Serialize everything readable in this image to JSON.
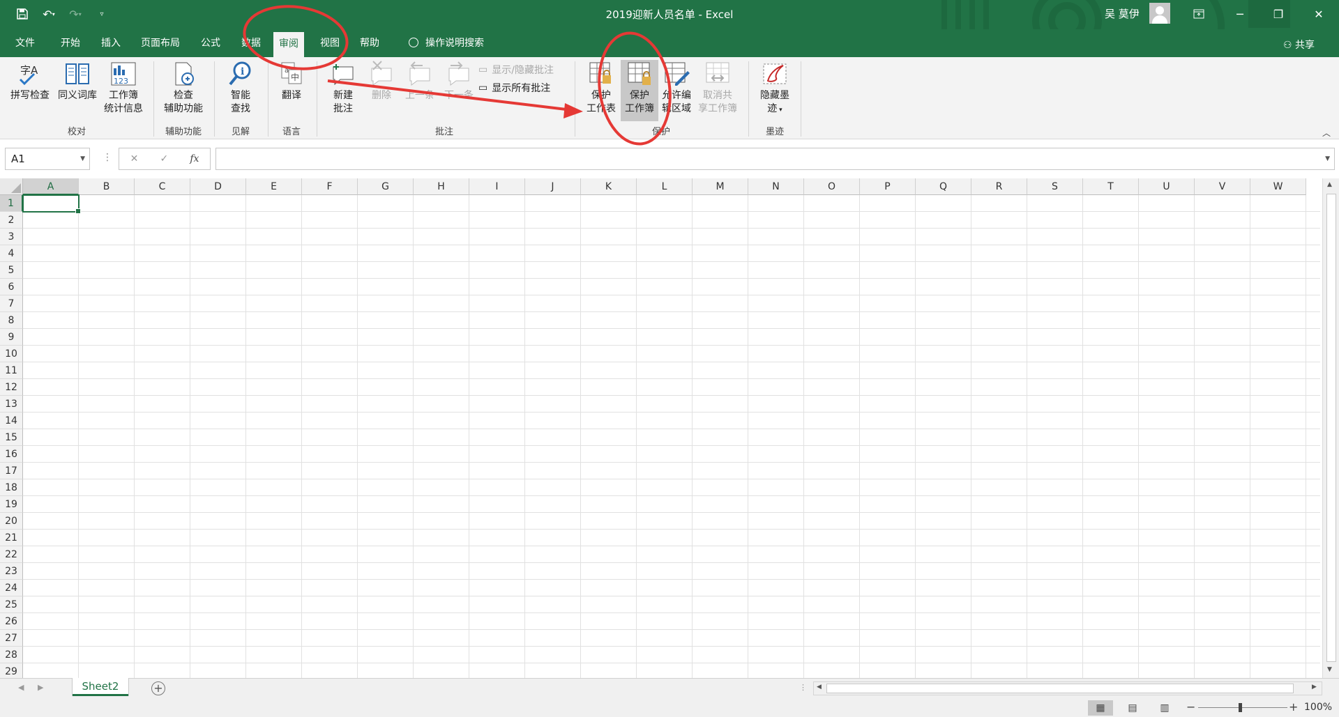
{
  "window": {
    "title": "2019迎新人员名单  -  Excel",
    "user_name": "吴 莫伊",
    "share_label": "共享"
  },
  "menu_tabs": [
    {
      "label": "文件"
    },
    {
      "label": "开始"
    },
    {
      "label": "插入"
    },
    {
      "label": "页面布局"
    },
    {
      "label": "公式"
    },
    {
      "label": "数据"
    },
    {
      "label": "审阅",
      "active": true
    },
    {
      "label": "视图"
    },
    {
      "label": "帮助"
    }
  ],
  "tell_me": "操作说明搜索",
  "ribbon": {
    "proofing": {
      "group_label": "校对",
      "spelling_l1": "拼写检查",
      "thesaurus_l1": "同义词库",
      "stats_l1": "工作簿",
      "stats_l2": "统计信息"
    },
    "accessibility": {
      "group_label": "辅助功能",
      "check_l1": "检查",
      "check_l2": "辅助功能"
    },
    "insights": {
      "group_label": "见解",
      "smart_l1": "智能",
      "smart_l2": "查找"
    },
    "language": {
      "group_label": "语言",
      "translate_l1": "翻译"
    },
    "comments": {
      "group_label": "批注",
      "new_l1": "新建",
      "new_l2": "批注",
      "delete_l1": "删除",
      "prev_l1": "上一条",
      "next_l1": "下一条",
      "show_hide": "显示/隐藏批注",
      "show_all": "显示所有批注"
    },
    "protect": {
      "group_label": "保护",
      "sheet_l1": "保护",
      "sheet_l2": "工作表",
      "workbook_l1": "保护",
      "workbook_l2": "工作簿",
      "edit_ranges_l1": "允许编",
      "edit_ranges_l2": "辑区域",
      "unshare_l1": "取消共",
      "unshare_l2": "享工作簿"
    },
    "ink": {
      "group_label": "墨迹",
      "hide_ink_l1": "隐藏墨",
      "hide_ink_l2": "迹"
    }
  },
  "formula_bar": {
    "name_box": "A1",
    "formula": "",
    "fx_label": "fx"
  },
  "columns": [
    "A",
    "B",
    "C",
    "D",
    "E",
    "F",
    "G",
    "H",
    "I",
    "J",
    "K",
    "L",
    "M",
    "N",
    "O",
    "P",
    "Q",
    "R",
    "S",
    "T",
    "U",
    "V",
    "W"
  ],
  "rows": [
    "1",
    "2",
    "3",
    "4",
    "5",
    "6",
    "7",
    "8",
    "9",
    "10",
    "11",
    "12",
    "13",
    "14",
    "15",
    "16",
    "17",
    "18",
    "19",
    "20",
    "21",
    "22",
    "23",
    "24",
    "25",
    "26",
    "27",
    "28",
    "29"
  ],
  "selected_cell": {
    "col": "A",
    "row": "1"
  },
  "sheets": [
    {
      "label": "Sheet2",
      "active": true
    }
  ],
  "status": {
    "zoom": "100%"
  },
  "colors": {
    "excel_green": "#217346",
    "annotation_red": "#e53935"
  }
}
